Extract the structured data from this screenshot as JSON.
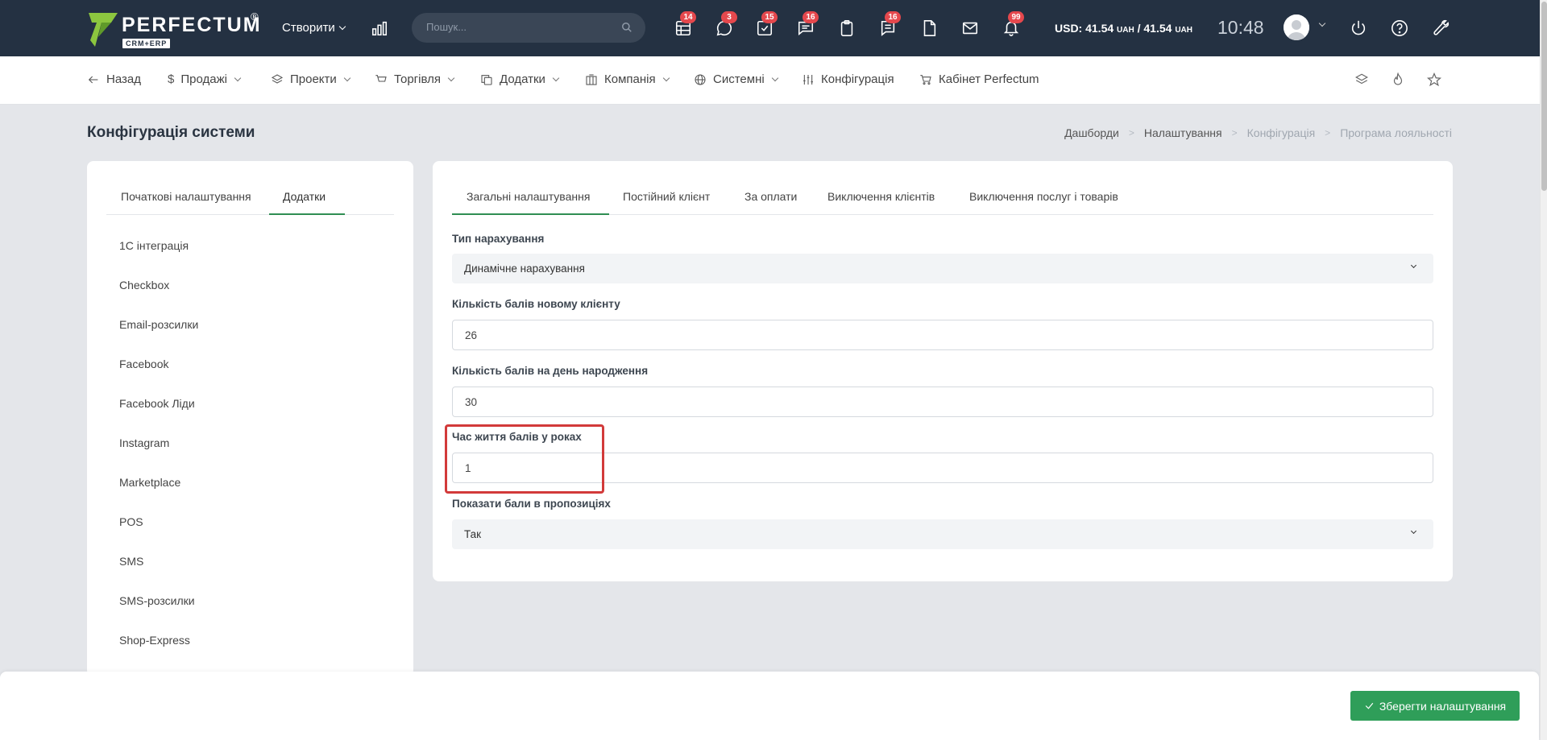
{
  "header": {
    "logo_text": "PERFECTUM",
    "logo_registered": "®",
    "logo_sub": "CRM+ERP",
    "create_label": "Створити",
    "search_placeholder": "Пошук...",
    "badges": {
      "table": "14",
      "chat": "3",
      "tasks": "15",
      "messages": "16",
      "notes": "16",
      "bell": "99"
    },
    "currency_prefix": "USD: 41.54",
    "currency_unit": "UAH",
    "currency_sep": " / 41.54",
    "time": "10:48"
  },
  "nav": {
    "back": "Назад",
    "sales": "Продажі",
    "projects": "Проекти",
    "trade": "Торгівля",
    "addons": "Додатки",
    "company": "Компанія",
    "system": "Системні",
    "config": "Конфігурація",
    "cabinet": "Кабінет Perfectum"
  },
  "page": {
    "title": "Конфігурація системи",
    "breadcrumb": [
      "Дашборди",
      "Налаштування",
      "Конфігурація",
      "Програма лояльності"
    ]
  },
  "left": {
    "tabs": [
      "Початкові налаштування",
      "Додатки"
    ],
    "items": [
      "1С інтеграція",
      "Checkbox",
      "Email-розсилки",
      "Facebook",
      "Facebook Ліди",
      "Instagram",
      "Marketplace",
      "POS",
      "SMS",
      "SMS-розсилки",
      "Shop-Express"
    ]
  },
  "right": {
    "tabs": [
      "Загальні налаштування",
      "Постійний клієнт",
      "За оплати",
      "Виключення клієнтів",
      "Виключення послуг і товарів"
    ],
    "fields": {
      "accrual_type_label": "Тип нарахування",
      "accrual_type_value": "Динамічне нарахування",
      "new_client_points_label": "Кількість балів новому клієнту",
      "new_client_points_value": "26",
      "birthday_points_label": "Кількість балів на день народження",
      "birthday_points_value": "30",
      "points_lifetime_label": "Час життя балів у роках",
      "points_lifetime_value": "1",
      "show_points_label": "Показати бали в пропозиціях",
      "show_points_value": "Так"
    }
  },
  "footer": {
    "save_label": "Зберегти налаштування"
  },
  "colors": {
    "header_bg": "#243142",
    "accent_green": "#2f9e59",
    "badge_red": "#e5484d",
    "highlight_red": "#d23a3a"
  }
}
